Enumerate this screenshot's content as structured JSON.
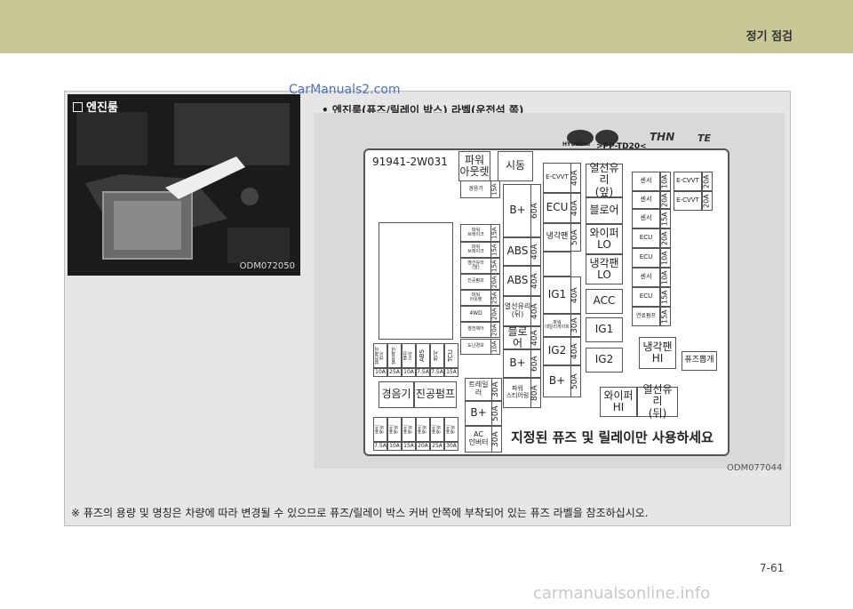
{
  "header": {
    "title": "정기 점검"
  },
  "watermark_top": "CarManuals2.com",
  "section": {
    "label": "엔진룸",
    "photo_code": "ODM072050"
  },
  "bullet_text": "엔진룸(퓨즈/릴레이 박스) 라벨(운전석 쪽)",
  "diagram": {
    "code": "ODM077044",
    "part_number": "91941-2W031",
    "top_logos": [
      "HYUNDAI",
      ">PP-TD20<",
      "THN",
      "TE"
    ],
    "footer_text": "지정된 퓨즈 및 릴레이만 사용하세요",
    "col1_small": [
      {
        "label": "경음기",
        "amp": "15A"
      },
      {
        "label": "파워\n브레이크",
        "amp": "15A"
      },
      {
        "label": "파워\n브레이크",
        "amp": "15A"
      },
      {
        "label": "열선유리\n(앞)",
        "amp": "15A"
      },
      {
        "label": "진공펌프",
        "amp": "20A"
      },
      {
        "label": "파워\n아웃렛",
        "amp": "25A"
      },
      {
        "label": "4WD",
        "amp": "20A"
      },
      {
        "label": "열전제어",
        "amp": "20A"
      },
      {
        "label": "도난경보",
        "amp": "10A"
      }
    ],
    "bottom_row_vertical": [
      "발전제어\n센서",
      "발전제어",
      "열선\n우리",
      "ABS",
      "센서",
      "TCU"
    ],
    "bottom_row_amps": [
      "10A",
      "25A",
      "10A",
      "7.5A",
      "7.5A",
      "15A"
    ],
    "relays_mid": {
      "horn": "경음기",
      "vac_pump": "진공펌프"
    },
    "spare_amps": [
      "7.5A",
      "10A",
      "15A",
      "20A",
      "25A",
      "30A"
    ],
    "spare_label": "퓨즈\n예비",
    "col2": {
      "power_outlet": "파워\n아웃렛",
      "start": "시동",
      "b1": "B+",
      "b1_amp": "60A",
      "abs1": "ABS",
      "abs1_amp": "40A",
      "abs2": "ABS",
      "abs2_amp": "40A",
      "rear_heat": "열선유리\n(뒤)",
      "rear_heat_amp": "40A",
      "blower": "블로어",
      "blower_amp": "40A",
      "b2": "B+",
      "b2_amp": "60A",
      "trailer": "트레일러",
      "trailer_amp": "30A",
      "b3": "B+",
      "b3_amp": "50A",
      "ac_inverter": "AC\n인버터",
      "ac_amp": "30A",
      "power_steer": "파워\n스티어링",
      "power_steer_amp": "80A"
    },
    "col3": {
      "ecvvt": "E-CVVT",
      "ecvvt_amp": "40A",
      "ecu": "ECU",
      "ecu_amp": "40A",
      "cool_fan": "냉각팬",
      "cool_fan_amp": "50A",
      "ig1": "IG1",
      "ig1_amp": "40A",
      "power_daylight": "파워\n데일리게이트",
      "power_daylight_amp": "30A",
      "ig2": "IG2",
      "ig2_amp": "40A",
      "bplus": "B+",
      "bplus_amp": "50A"
    },
    "col4": {
      "front_heat": "열선유리\n(앞)",
      "blower": "블로어",
      "wiper_lo": "와이퍼\nLO",
      "fan_lo": "냉각팬\nLO",
      "acc": "ACC",
      "ig1": "IG1",
      "ig2": "IG2"
    },
    "col5": [
      {
        "label": "센서",
        "amp": "10A"
      },
      {
        "label": "센서",
        "amp": "20A"
      },
      {
        "label": "센서",
        "amp": "15A"
      },
      {
        "label": "ECU",
        "amp": "20A"
      },
      {
        "label": "ECU",
        "amp": "10A"
      },
      {
        "label": "센서",
        "amp": "10A"
      },
      {
        "label": "ECU",
        "amp": "15A"
      },
      {
        "label": "연료펌프",
        "amp": "15A"
      }
    ],
    "col6": [
      {
        "label": "E-CVVT",
        "amp": "20A"
      },
      {
        "label": "E-CVVT",
        "amp": "20A"
      }
    ],
    "bottom_right": {
      "fan_hi": "냉각팬\nHI",
      "fuse_puller": "퓨즈뽑개",
      "wiper_hi": "와이퍼\nHI",
      "rear_heat": "열선유리\n(뒤)"
    }
  },
  "note": "※  퓨즈의 용량 및 명칭은 차량에 따라 변경될 수 있으므로 퓨즈/릴레이 박스 커버 안쪽에 부착되어 있는 퓨즈 라벨을 참조하십시오.",
  "page_number": "7-61",
  "footer_watermark": "carmanualsonline.info"
}
